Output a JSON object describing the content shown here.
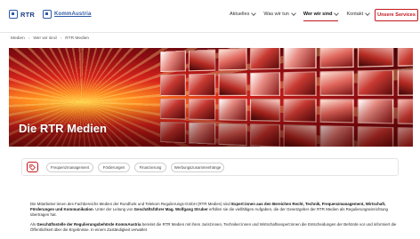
{
  "header": {
    "logo_rtr": "RTR",
    "logo_ka": "KommAustria",
    "nav": [
      {
        "label": "Aktuelles",
        "active": false
      },
      {
        "label": "Was wir tun",
        "active": false
      },
      {
        "label": "Wer wir sind",
        "active": true
      },
      {
        "label": "Kontakt",
        "active": false
      }
    ],
    "cta_label": "Unsere Services"
  },
  "breadcrumb": [
    "Medien",
    "Wer wir sind",
    "RTR Medien"
  ],
  "hero": {
    "title": "Die RTR Medien"
  },
  "tags": {
    "icon": "tag-icon",
    "items": [
      "Frequenzmanagement",
      "Förderungen",
      "Finanzierung",
      "Werbungszusammenhänge"
    ]
  },
  "content": {
    "p1_a": "Die Mitarbeiter:innen des Fachbereichs Medien der Rundfunk und Telekom Regulierungs-GmbH (RTR Medien) sind ",
    "p1_b": "Expert:innen aus den Bereichen Recht, Technik, Frequenzmanagement, Wirtschaft, Förderungen und Kommunikation",
    "p1_c": ". Unter der Leitung von ",
    "p1_d": "Geschäftsführer Mag. Wolfgang Struber",
    "p1_e": " erfüllen sie die vielfältigen Aufgaben, die der Gesetzgeber der RTR Medien als Regulierungseinrichtung übertragen hat.",
    "p2_a": "Als ",
    "p2_b": "Geschäftsstelle der Regulierungsbehörde KommAustria",
    "p2_c": " bereitet die RTR Medien mit ihren Jurist:innen, Techniker:innen und Wirtschaftsexpert:innen die Entscheidungen der Behörde vor und informiert die Öffentlichkeit über die Ergebnisse. In einem Zuständigkeit verwaltet"
  },
  "colors": {
    "accent": "#c4161c",
    "brand_blue": "#2f5aa8"
  }
}
